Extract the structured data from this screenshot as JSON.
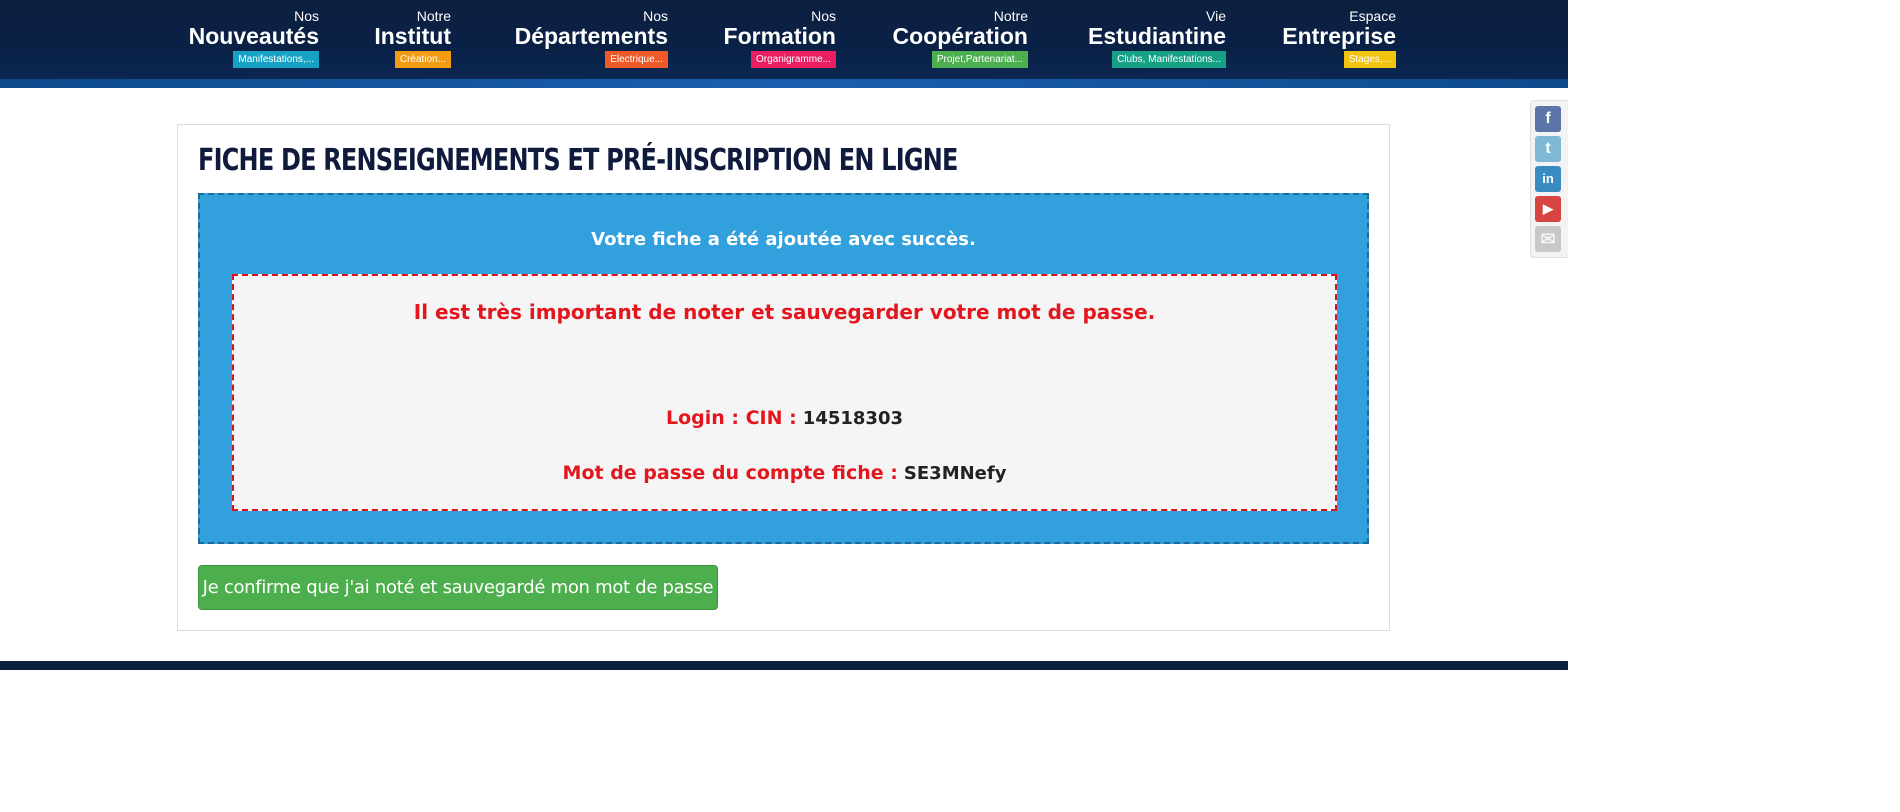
{
  "nav": [
    {
      "top": "Nos",
      "main": "Nouveautés",
      "badge": "Manifestations,...",
      "color": "#17a2c4"
    },
    {
      "top": "Notre",
      "main": "Institut",
      "badge": "Création...",
      "color": "#f39c12"
    },
    {
      "top": "Nos",
      "main": "Départements",
      "badge": "Electrique...",
      "color": "#f05a28"
    },
    {
      "top": "Nos",
      "main": "Formation",
      "badge": "Organigramme...",
      "color": "#e91e63"
    },
    {
      "top": "Notre",
      "main": "Coopération",
      "badge": "Projet,Partenariat...",
      "color": "#4caf50"
    },
    {
      "top": "Vie",
      "main": "Estudiantine",
      "badge": "Clubs, Manifestations...",
      "color": "#16a085"
    },
    {
      "top": "Espace",
      "main": "Entreprise",
      "badge": "Stages,...",
      "color": "#f1c40f"
    }
  ],
  "page": {
    "title": "FICHE DE RENSEIGNEMENTS ET PRÉ-INSCRIPTION EN LIGNE",
    "success": "Votre fiche a été ajoutée avec succès.",
    "warning": "Il est très important de noter et sauvegarder votre mot de passe.",
    "login_label": "Login : CIN :",
    "login_value": "14518303",
    "password_label": "Mot de passe du compte fiche :",
    "password_value": "SE3MNefy",
    "confirm_button": "Je confirme que j'ai noté et sauvegardé mon mot de passe"
  },
  "social": [
    {
      "icon": "facebook-icon",
      "glyph": "f",
      "color": "#5b75a8"
    },
    {
      "icon": "twitter-icon",
      "glyph": "t",
      "color": "#7fb8d4"
    },
    {
      "icon": "linkedin-icon",
      "glyph": "in",
      "color": "#3a8bbf"
    },
    {
      "icon": "youtube-icon",
      "glyph": "▶",
      "color": "#d64541"
    },
    {
      "icon": "email-icon",
      "glyph": "✉",
      "color": "#c8c8c8"
    }
  ],
  "colors": {
    "header_bg": "#0c1f3f",
    "box_blue": "#31a0dc",
    "warning_red": "#e3161e",
    "button_green": "#4cae4c"
  }
}
